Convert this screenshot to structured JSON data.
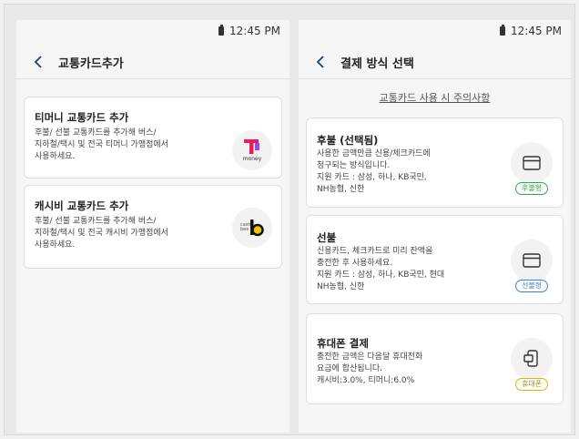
{
  "status": {
    "time": "12:45 PM"
  },
  "left_screen": {
    "title": "교통카드추가",
    "cards": [
      {
        "title": "티머니 교통카드 추가",
        "desc_lines": [
          "후불/ 선불 교통카드를 추가해 버스/",
          "지하철/택시 및 전국 티머니 가맹점에서",
          "사용하세요."
        ],
        "logo_text": "money"
      },
      {
        "title": "캐시비 교통카드 추가",
        "desc_lines": [
          "후불/ 선불 교통카드를 추가해 버스/",
          "지하철/택시 및 전국 캐시비 가맹점에서",
          "사용하세요."
        ],
        "logo_text": "cash bee"
      }
    ]
  },
  "right_screen": {
    "title": "결제 방식 선택",
    "notice_link": "교통카드 사용 시 주의사항",
    "options": [
      {
        "title": "후불 (선택됨)",
        "desc_lines": [
          "사용한 금액만큼 신용/체크카드에",
          "청구되는 방식입니다.",
          "지원 카드 : 삼성, 하나, KB국민,",
          "NH농협, 신한"
        ],
        "badge": "후불형",
        "badge_color": "#2eaa4a"
      },
      {
        "title": "선불",
        "desc_lines": [
          "신용카드, 체크카드로 미리 잔액을",
          "충전한 후 사용하세요.",
          "지원 카드 : 삼성, 하나, KB국민, 현대",
          "NH농협, 신한"
        ],
        "badge": "선불형",
        "badge_color": "#3c7fd6"
      },
      {
        "title": "휴대폰 결제",
        "desc_lines": [
          "충전한 금액은 다음달 휴대전화",
          "요금에 합산됩니다.",
          "캐시비:3.0%, 티머니:6.0%"
        ],
        "badge": "휴대폰",
        "badge_color": "#e0b400"
      }
    ]
  }
}
